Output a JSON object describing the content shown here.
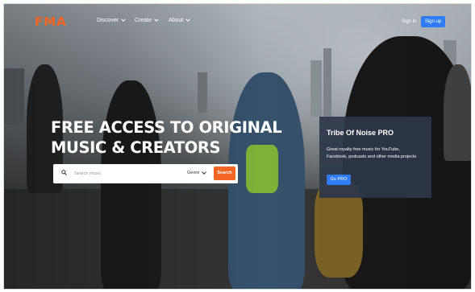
{
  "brand": {
    "logo_text": "FMA",
    "logo_color": "#f26522"
  },
  "nav": {
    "items": [
      {
        "label": "Discover"
      },
      {
        "label": "Create"
      },
      {
        "label": "About"
      }
    ],
    "sign_in": "Sign in",
    "sign_up": "Sign up",
    "accent": "#2f7cf6"
  },
  "hero": {
    "headline_line1": "FREE ACCESS TO ORIGINAL",
    "headline_line2": "MUSIC & CREATORS"
  },
  "search": {
    "icon": "search-icon",
    "placeholder": "Search music",
    "genre_label": "Genre",
    "button_label": "Search",
    "button_color": "#f26522"
  },
  "promo": {
    "title": "Tribe Of Noise PRO",
    "description": "Great royalty free music for YouTube, Facebook, podcasts and other media projects",
    "button_label": "Go PRO"
  }
}
